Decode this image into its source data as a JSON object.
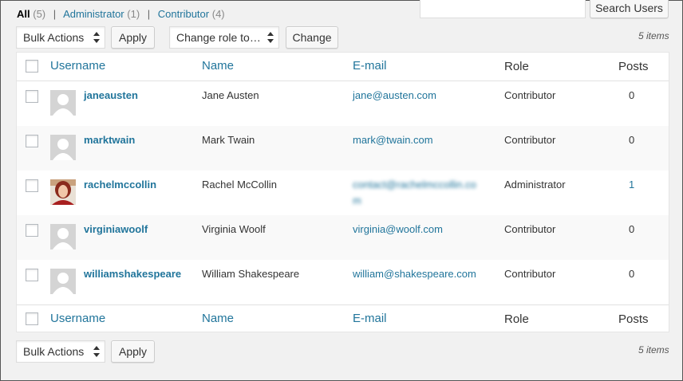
{
  "filters": {
    "all_label": "All",
    "all_count": "(5)",
    "admin_label": "Administrator",
    "admin_count": "(1)",
    "contrib_label": "Contributor",
    "contrib_count": "(4)",
    "separator": "|"
  },
  "search": {
    "value": "",
    "button": "Search Users"
  },
  "top_actions": {
    "bulk_select": "Bulk Actions",
    "apply": "Apply",
    "role_select": "Change role to…",
    "change": "Change",
    "count": "5 items"
  },
  "bottom_actions": {
    "bulk_select": "Bulk Actions",
    "apply": "Apply",
    "count": "5 items"
  },
  "columns": {
    "username": "Username",
    "name": "Name",
    "email": "E-mail",
    "role": "Role",
    "posts": "Posts"
  },
  "users": [
    {
      "username": "janeausten",
      "name": "Jane Austen",
      "email": "jane@austen.com",
      "role": "Contributor",
      "posts": "0",
      "avatar": "default-avatar-icon"
    },
    {
      "username": "marktwain",
      "name": "Mark Twain",
      "email": "mark@twain.com",
      "role": "Contributor",
      "posts": "0",
      "avatar": "default-avatar-icon"
    },
    {
      "username": "rachelmccollin",
      "name": "Rachel McCollin",
      "email": "contact@rachelmccollin.co",
      "email_line2": "m",
      "role": "Administrator",
      "posts": "1",
      "avatar": "photo-avatar"
    },
    {
      "username": "virginiawoolf",
      "name": "Virginia Woolf",
      "email": "virginia@woolf.com",
      "role": "Contributor",
      "posts": "0",
      "avatar": "default-avatar-icon"
    },
    {
      "username": "williamshakespeare",
      "name": "William Shakespeare",
      "email": "william@shakespeare.com",
      "role": "Contributor",
      "posts": "0",
      "avatar": "default-avatar-icon"
    }
  ],
  "colors": {
    "link": "#21759b",
    "background": "#f1f1f1",
    "alt_row": "#f9f9f9"
  }
}
